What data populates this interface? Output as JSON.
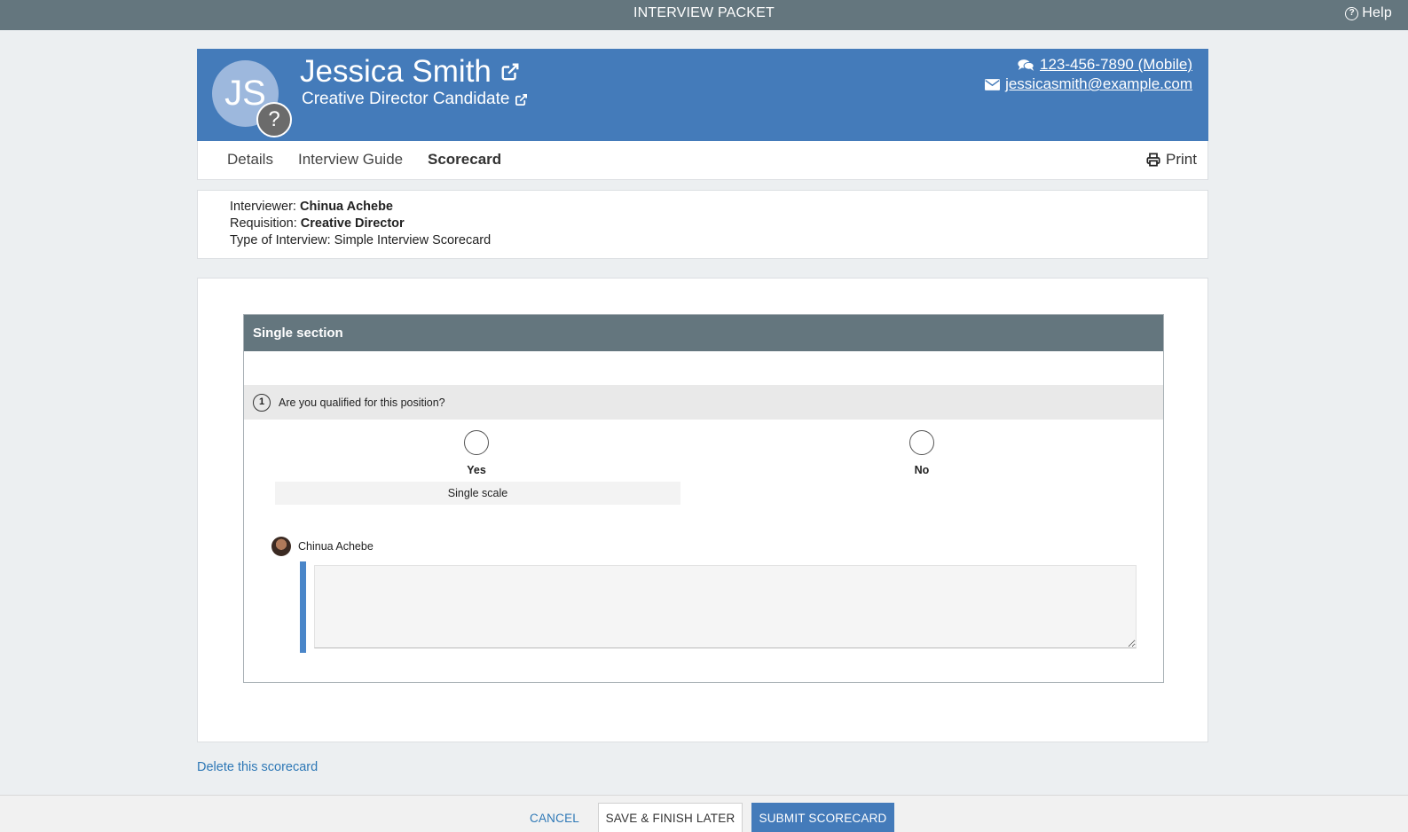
{
  "topbar": {
    "title": "INTERVIEW PACKET",
    "help_label": "Help"
  },
  "candidate": {
    "initials": "JS",
    "badge": "?",
    "name": "Jessica Smith",
    "subtitle": "Creative Director Candidate",
    "phone": "123-456-7890 (Mobile)",
    "email": "jessicasmith@example.com"
  },
  "tabs": [
    {
      "label": "Details"
    },
    {
      "label": "Interview Guide"
    },
    {
      "label": "Scorecard",
      "active": true
    }
  ],
  "print_label": "Print",
  "info": {
    "interviewer_label": "Interviewer:",
    "interviewer": "Chinua Achebe",
    "requisition_label": "Requisition:",
    "requisition": "Creative Director",
    "type_label": "Type of Interview:",
    "type": "Simple Interview Scorecard"
  },
  "section": {
    "title": "Single section",
    "question_number": "1",
    "question": "Are you qualified for this position?",
    "options": [
      "Yes",
      "No"
    ],
    "scale_label": "Single scale",
    "commenter": "Chinua Achebe",
    "comment_value": ""
  },
  "delete_label": "Delete this scorecard",
  "footer": {
    "cancel": "CANCEL",
    "save": "SAVE & FINISH LATER",
    "submit": "SUBMIT SCORECARD"
  },
  "colors": {
    "header_bg": "#447bba",
    "topbar_bg": "#64767e",
    "link": "#2e78b6"
  }
}
